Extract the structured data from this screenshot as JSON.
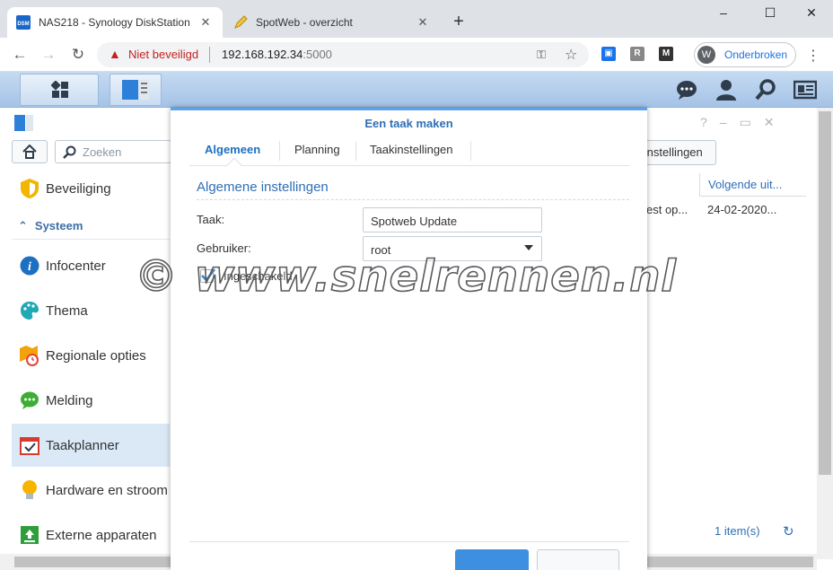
{
  "browser": {
    "tabs": [
      {
        "title": "NAS218 - Synology DiskStation",
        "favicon": "DSM"
      },
      {
        "title": "SpotWeb - overzicht"
      }
    ],
    "new_tab": "+",
    "window_controls": {
      "minimize": "–",
      "maximize": "☐",
      "close": "✕"
    },
    "security_label": "Niet beveiligd",
    "url_host": "192.168.192.34",
    "url_port": ":5000",
    "extensions": [
      "R",
      "M"
    ],
    "profile": {
      "initial": "W",
      "label": "Onderbroken"
    }
  },
  "app": {
    "search_placeholder": "Zoeken",
    "settings_button": "Instellingen",
    "group_label": "Systeem",
    "sidebar": [
      {
        "label": "Beveiliging",
        "icon": "shield-icon"
      },
      {
        "label": "Infocenter",
        "icon": "info-icon"
      },
      {
        "label": "Thema",
        "icon": "palette-icon"
      },
      {
        "label": "Regionale opties",
        "icon": "map-clock-icon"
      },
      {
        "label": "Melding",
        "icon": "chat-bubble-icon"
      },
      {
        "label": "Taakplanner",
        "icon": "calendar-check-icon",
        "selected": true
      },
      {
        "label": "Hardware en stroom",
        "icon": "bulb-icon"
      },
      {
        "label": "Externe apparaten",
        "icon": "upload-box-icon"
      }
    ],
    "table": {
      "column_next_run": "Volgende uit...",
      "row_partial_cell": "est op...",
      "row_next_run": "24-02-2020..."
    },
    "items_count": "1 item(s)"
  },
  "dialog": {
    "title": "Een taak maken",
    "tabs": [
      "Algemeen",
      "Planning",
      "Taakinstellingen"
    ],
    "section_title": "Algemene instellingen",
    "task_label": "Taak:",
    "task_value": "Spotweb Update",
    "user_label": "Gebruiker:",
    "user_value": "root",
    "enabled_label": "Ingeschakeld",
    "enabled": true
  },
  "watermark": "© www.snelrennen.nl",
  "colors": {
    "accent": "#2f6fb5",
    "dsm_bar": "#a5c3e6",
    "insecure": "#c5221f",
    "selected_row": "#dbe9f7"
  }
}
